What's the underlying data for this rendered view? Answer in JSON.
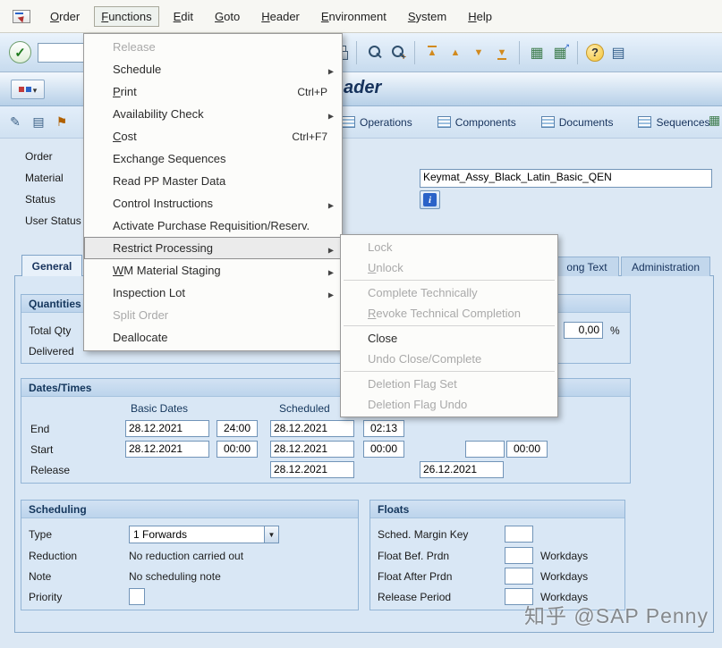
{
  "colors": {
    "title_text": "#16325c",
    "disabled_menu_text": "#a9a9a9",
    "menu_highlight": "#ebebeb",
    "info_icon_blue": "#2a63c8",
    "panel_background": "#d9e7f5"
  },
  "menubar": {
    "items": [
      {
        "label": "Order"
      },
      {
        "label": "Functions"
      },
      {
        "label": "Edit"
      },
      {
        "label": "Goto"
      },
      {
        "label": "Header"
      },
      {
        "label": "Environment"
      },
      {
        "label": "System"
      },
      {
        "label": "Help"
      }
    ]
  },
  "toolbar": {
    "command_field_value": "",
    "icons": [
      "enter-check",
      "printer",
      "find",
      "find-next",
      "first-page",
      "previous-page",
      "next-page",
      "last-page",
      "table-settings",
      "table-export",
      "help",
      "layout"
    ]
  },
  "title_bar": {
    "title": "ader"
  },
  "app_toolbar": {
    "left_icons": [
      "pencil",
      "document",
      "flag"
    ],
    "buttons": [
      {
        "label": "Operations"
      },
      {
        "label": "Components"
      },
      {
        "label": "Documents"
      },
      {
        "label": "Sequences"
      }
    ]
  },
  "header": {
    "order_label": "Order",
    "material_label": "Material",
    "material_value": "Keymat_Assy_Black_Latin_Basic_QEN",
    "status_label": "Status",
    "user_status_label": "User Status"
  },
  "tabs": {
    "general": "General",
    "long_text": "ong Text",
    "administration": "Administration"
  },
  "quantities": {
    "title": "Quantities",
    "total_qty_label": "Total Qty",
    "delivered_label": "Delivered",
    "percent_value": "0,00",
    "percent_sign": "%"
  },
  "dates": {
    "title": "Dates/Times",
    "columns": {
      "basic": "Basic Dates",
      "scheduled": "Scheduled"
    },
    "end": {
      "label": "End",
      "basic_date": "28.12.2021",
      "basic_time": "24:00",
      "sched_date": "28.12.2021",
      "sched_time": "02:13"
    },
    "start": {
      "label": "Start",
      "basic_date": "28.12.2021",
      "basic_time": "00:00",
      "sched_date": "28.12.2021",
      "sched_time": "00:00",
      "confirmed_date": "",
      "confirmed_time": "00:00"
    },
    "release": {
      "label": "Release",
      "sched_date": "28.12.2021",
      "confirmed_date": "26.12.2021"
    }
  },
  "scheduling": {
    "title": "Scheduling",
    "type_label": "Type",
    "type_value": "1 Forwards",
    "reduction_label": "Reduction",
    "reduction_value": "No reduction carried out",
    "note_label": "Note",
    "note_value": "No scheduling note",
    "priority_label": "Priority",
    "priority_value": ""
  },
  "floats": {
    "title": "Floats",
    "sched_margin_key_label": "Sched. Margin Key",
    "float_before_label": "Float Bef. Prdn",
    "float_after_label": "Float After Prdn",
    "release_period_label": "Release Period",
    "workdays_label": "Workdays",
    "sched_margin_key_value": "",
    "float_before_value": "",
    "float_after_value": "",
    "release_period_value": ""
  },
  "functions_menu": {
    "items": [
      {
        "label": "Release",
        "disabled": true
      },
      {
        "label": "Schedule",
        "has_submenu": true
      },
      {
        "label": "Print",
        "shortcut": "Ctrl+P"
      },
      {
        "label": "Availability Check",
        "has_submenu": true
      },
      {
        "label": "Cost",
        "shortcut": "Ctrl+F7"
      },
      {
        "label": "Exchange Sequences"
      },
      {
        "label": "Read PP Master Data"
      },
      {
        "label": "Control Instructions",
        "has_submenu": true
      },
      {
        "label": "Activate Purchase Requisition/Reserv."
      },
      {
        "label": "Restrict Processing",
        "has_submenu": true,
        "highlighted": true
      },
      {
        "label": "WM Material Staging",
        "has_submenu": true
      },
      {
        "label": "Inspection Lot",
        "has_submenu": true
      },
      {
        "label": "Split Order",
        "disabled": true
      },
      {
        "label": "Deallocate"
      }
    ]
  },
  "restrict_submenu": {
    "items": [
      {
        "label": "Lock",
        "disabled": true
      },
      {
        "label": "Unlock",
        "disabled": true
      },
      {
        "label": "Complete Technically",
        "disabled": true
      },
      {
        "label": "Revoke Technical Completion",
        "disabled": true
      },
      {
        "label": "Close",
        "disabled": false
      },
      {
        "label": "Undo Close/Complete",
        "disabled": true
      },
      {
        "label": "Deletion Flag Set",
        "disabled": true
      },
      {
        "label": "Deletion Flag Undo",
        "disabled": true
      }
    ]
  },
  "watermark": {
    "text": "知乎 @SAP Penny"
  }
}
